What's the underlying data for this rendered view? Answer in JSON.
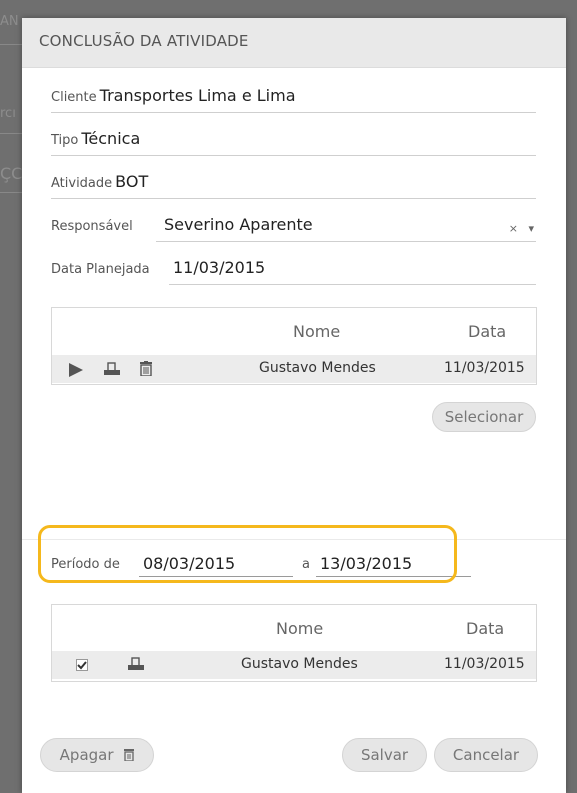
{
  "background": {
    "hints": [
      "AN",
      "rcı",
      "ÇC"
    ]
  },
  "modal": {
    "title": "CONCLUSÃO DA ATIVIDADE",
    "fields": {
      "cliente": {
        "label": "Cliente",
        "value": "Transportes Lima e Lima"
      },
      "tipo": {
        "label": "Tipo",
        "value": "Técnica"
      },
      "atividade": {
        "label": "Atividade",
        "value": "BOT"
      },
      "responsavel": {
        "label": "Responsável",
        "value": "Severino Aparente",
        "clear": "×",
        "caret": "▾"
      },
      "data_planejada": {
        "label": "Data Planejada",
        "value": "11/03/2015"
      }
    },
    "grid1": {
      "headers": {
        "nome": "Nome",
        "data": "Data"
      },
      "row": {
        "nome": "Gustavo Mendes",
        "data": "11/03/2015"
      }
    },
    "selecionar_label": "Selecionar",
    "periodo": {
      "label_de": "Período de",
      "from": "08/03/2015",
      "label_a": "a",
      "to": "13/03/2015"
    },
    "grid2": {
      "headers": {
        "nome": "Nome",
        "data": "Data"
      },
      "row": {
        "checked": true,
        "nome": "Gustavo Mendes",
        "data": "11/03/2015"
      }
    },
    "buttons": {
      "apagar": "Apagar",
      "salvar": "Salvar",
      "cancelar": "Cancelar"
    }
  },
  "colors": {
    "highlight": "#f5b81c",
    "overlay": "#6f6f6f"
  }
}
